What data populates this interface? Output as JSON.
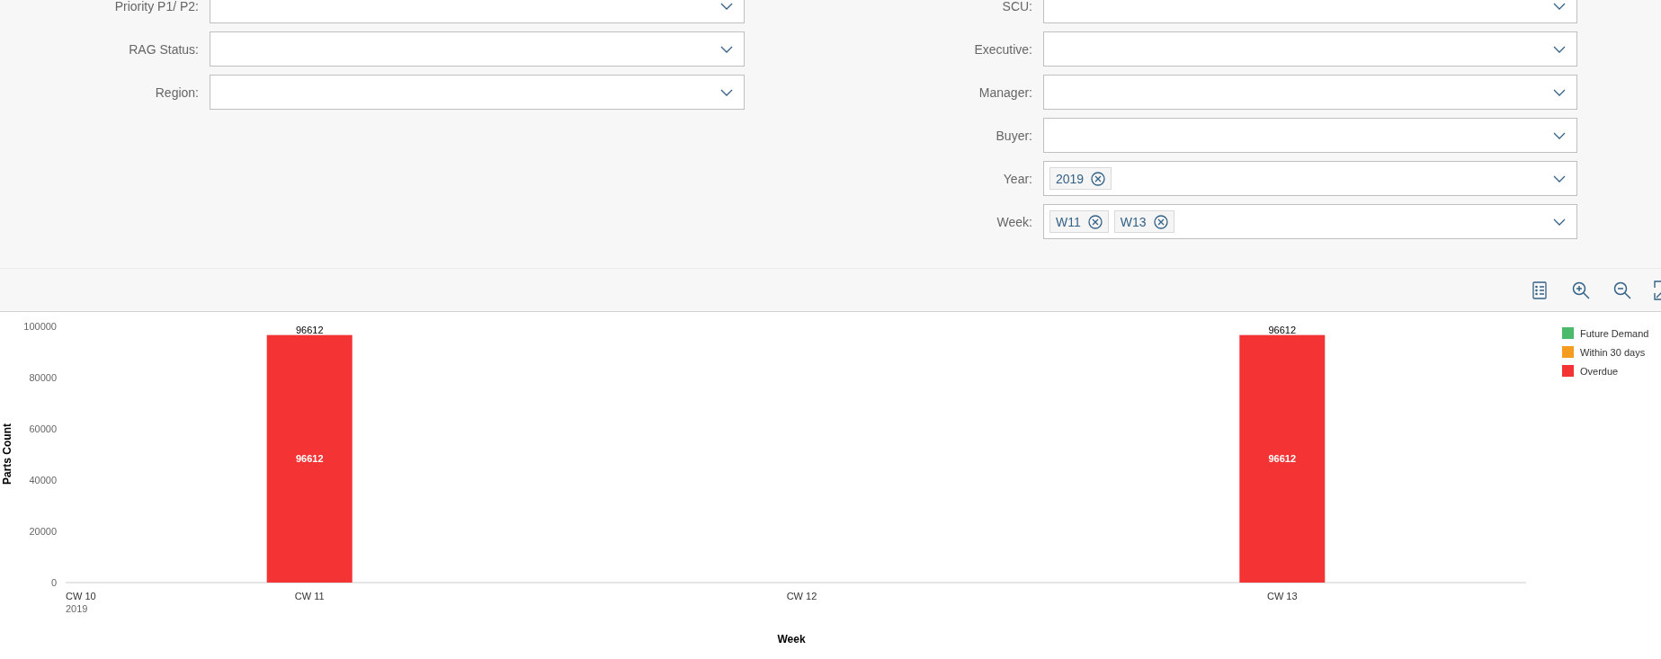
{
  "filters": {
    "left": [
      {
        "label": "Priority P1/ P2:"
      },
      {
        "label": "RAG Status:"
      },
      {
        "label": "Region:"
      }
    ],
    "right": [
      {
        "label": "SCU:"
      },
      {
        "label": "Executive:"
      },
      {
        "label": "Manager:"
      },
      {
        "label": "Buyer:"
      },
      {
        "label": "Year:",
        "tokens": [
          "2019"
        ]
      },
      {
        "label": "Week:",
        "tokens": [
          "W11",
          "W13"
        ]
      }
    ]
  },
  "chart": {
    "chart_data": {
      "type": "bar",
      "stacked": true,
      "xlabel": "Week",
      "ylabel": "Parts Count",
      "categories": [
        "CW 10",
        "CW 11",
        "CW 12",
        "CW 13"
      ],
      "annotations": [
        "2019"
      ],
      "ylim": [
        0,
        100000
      ],
      "yticks": [
        0,
        20000,
        40000,
        60000,
        80000,
        100000
      ],
      "data_labels": true,
      "series": [
        {
          "name": "Future Demand",
          "color": "#4cba6b",
          "values": [
            null,
            null,
            null,
            null
          ]
        },
        {
          "name": "Within 30 days",
          "color": "#f39c1f",
          "values": [
            null,
            null,
            null,
            null
          ]
        },
        {
          "name": "Overdue",
          "color": "#f33334",
          "values": [
            null,
            96612,
            null,
            96612
          ]
        }
      ],
      "totals": [
        null,
        "96612",
        null,
        "96612"
      ]
    }
  }
}
